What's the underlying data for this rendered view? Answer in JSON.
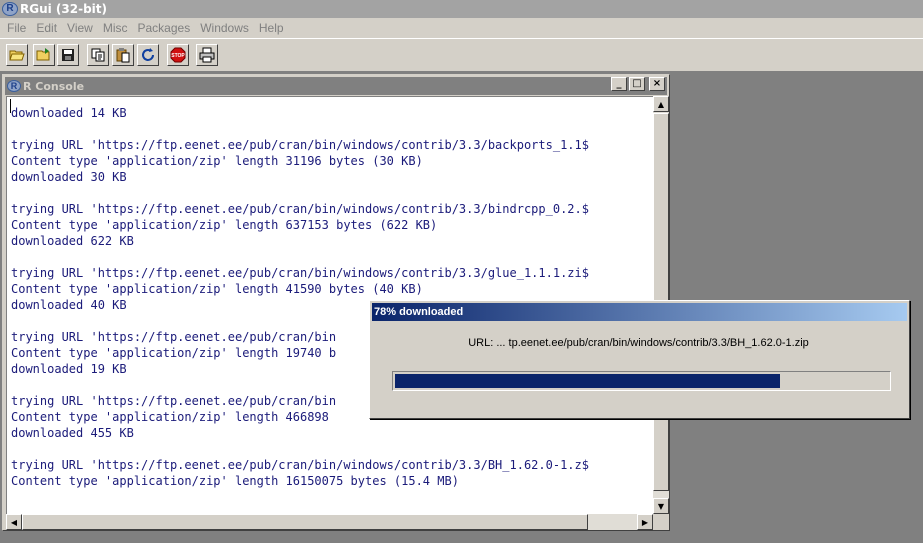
{
  "app": {
    "title": "RGui (32-bit)",
    "logo_letter": "R"
  },
  "menubar": {
    "items": [
      "File",
      "Edit",
      "View",
      "Misc",
      "Packages",
      "Windows",
      "Help"
    ]
  },
  "toolbar": {
    "buttons": [
      "open-icon",
      "load-workspace-icon",
      "save-icon",
      "copy-icon",
      "paste-icon",
      "refresh-icon",
      "stop-icon",
      "print-icon"
    ],
    "stop_label": "STOP"
  },
  "console": {
    "title": "R Console",
    "minimize": "_",
    "maximize": "□",
    "close": "×",
    "text": "downloaded 14 KB\n\ntrying URL 'https://ftp.eenet.ee/pub/cran/bin/windows/contrib/3.3/backports_1.1$\nContent type 'application/zip' length 31196 bytes (30 KB)\ndownloaded 30 KB\n\ntrying URL 'https://ftp.eenet.ee/pub/cran/bin/windows/contrib/3.3/bindrcpp_0.2.$\nContent type 'application/zip' length 637153 bytes (622 KB)\ndownloaded 622 KB\n\ntrying URL 'https://ftp.eenet.ee/pub/cran/bin/windows/contrib/3.3/glue_1.1.1.zi$\nContent type 'application/zip' length 41590 bytes (40 KB)\ndownloaded 40 KB\n\ntrying URL 'https://ftp.eenet.ee/pub/cran/bin\nContent type 'application/zip' length 19740 b\ndownloaded 19 KB\n\ntrying URL 'https://ftp.eenet.ee/pub/cran/bin\nContent type 'application/zip' length 466898 \ndownloaded 455 KB\n\ntrying URL 'https://ftp.eenet.ee/pub/cran/bin/windows/contrib/3.3/BH_1.62.0-1.z$\nContent type 'application/zip' length 16150075 bytes (15.4 MB)"
  },
  "scrollbar": {
    "up": "▲",
    "down": "▼",
    "left": "◀",
    "right": "▶"
  },
  "download_dialog": {
    "title": "78% downloaded",
    "url_text": "URL: ... tp.eenet.ee/pub/cran/bin/windows/contrib/3.3/BH_1.62.0-1.zip",
    "progress_percent": 78,
    "progress_color": "#0a246a"
  }
}
